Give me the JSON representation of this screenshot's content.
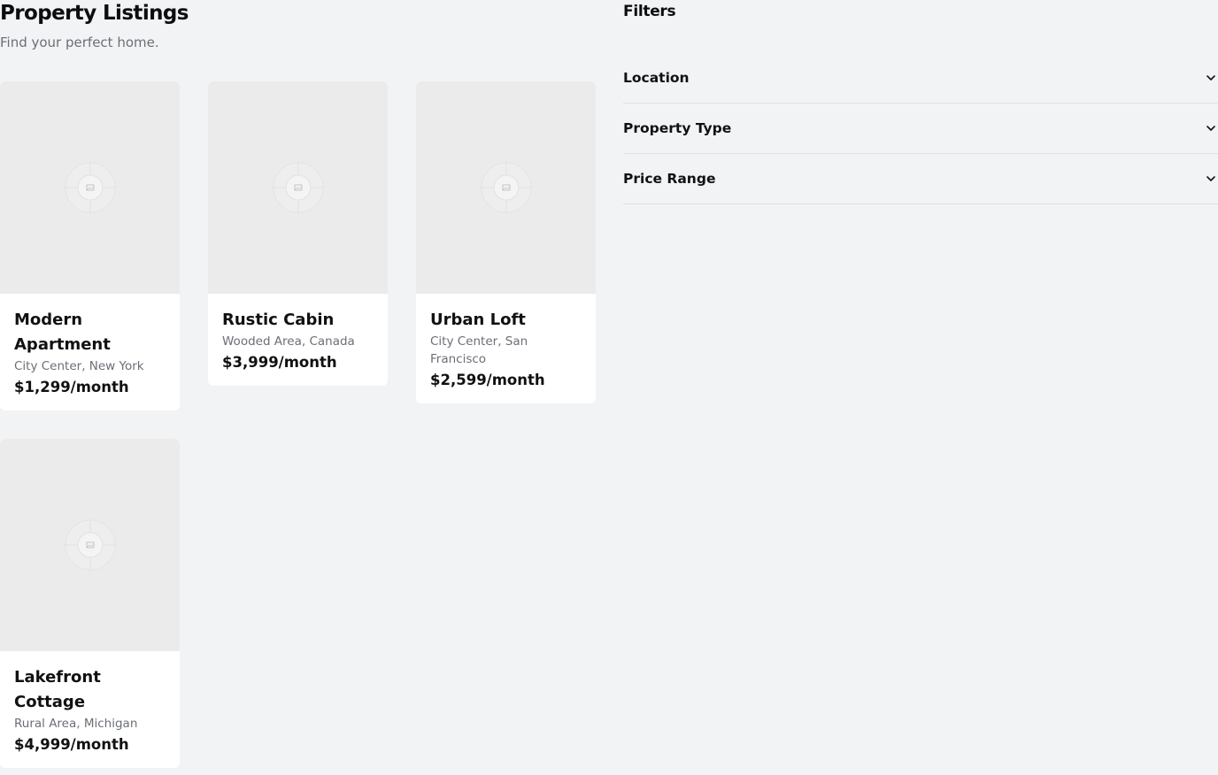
{
  "header": {
    "title": "Property Listings",
    "subtitle": "Find your perfect home."
  },
  "listings": [
    {
      "title": "Modern Apartment",
      "location": "City Center, New York",
      "price": "$1,299/month"
    },
    {
      "title": "Rustic Cabin",
      "location": "Wooded Area, Canada",
      "price": "$3,999/month"
    },
    {
      "title": "Urban Loft",
      "location": "City Center, San Francisco",
      "price": "$2,599/month"
    },
    {
      "title": "Lakefront Cottage",
      "location": "Rural Area, Michigan",
      "price": "$4,999/month"
    }
  ],
  "filters": {
    "title": "Filters",
    "items": [
      {
        "label": "Location",
        "icon": "chevron-down-icon"
      },
      {
        "label": "Property Type",
        "icon": "chevron-down-icon"
      },
      {
        "label": "Price Range",
        "icon": "chevron-down-icon"
      }
    ]
  },
  "colors": {
    "background": "#f2f3f5",
    "card": "#ffffff",
    "image_placeholder": "#ebebeb",
    "muted_text": "#6b6f76",
    "divider": "#dfe1e4"
  }
}
